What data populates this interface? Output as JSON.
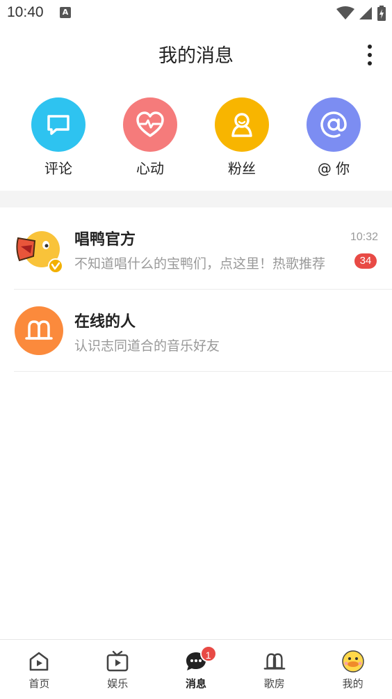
{
  "status_bar": {
    "time": "10:40",
    "notification_badge": "A"
  },
  "header": {
    "title": "我的消息"
  },
  "quick_actions": [
    {
      "label": "评论",
      "icon": "comment-icon",
      "color": "#2ec3f0"
    },
    {
      "label": "心动",
      "icon": "heartbeat-icon",
      "color": "#f57b7b"
    },
    {
      "label": "粉丝",
      "icon": "fans-icon",
      "color": "#f8b500"
    },
    {
      "label": "@ 你",
      "icon": "at-icon",
      "color": "#7c8df2"
    }
  ],
  "messages": [
    {
      "title": "唱鸭官方",
      "subtitle": "不知道唱什么的宝鸭们，点这里！热歌推荐",
      "time": "10:32",
      "badge": "34",
      "avatar": "duck-mascot-avatar"
    },
    {
      "title": "在线的人",
      "subtitle": "认识志同道合的音乐好友",
      "avatar": "online-people-icon",
      "avatar_color": "#fb8a3c"
    }
  ],
  "bottom_nav": {
    "items": [
      {
        "label": "首页",
        "icon": "home-play-icon"
      },
      {
        "label": "娱乐",
        "icon": "tv-play-icon"
      },
      {
        "label": "消息",
        "icon": "chat-bubble-icon",
        "badge": "1",
        "active": true
      },
      {
        "label": "歌房",
        "icon": "room-people-icon"
      },
      {
        "label": "我的",
        "icon": "duck-profile-icon"
      }
    ]
  },
  "colors": {
    "badge_red": "#e84a45",
    "separator": "#ececec",
    "section_band": "#f4f4f4"
  }
}
